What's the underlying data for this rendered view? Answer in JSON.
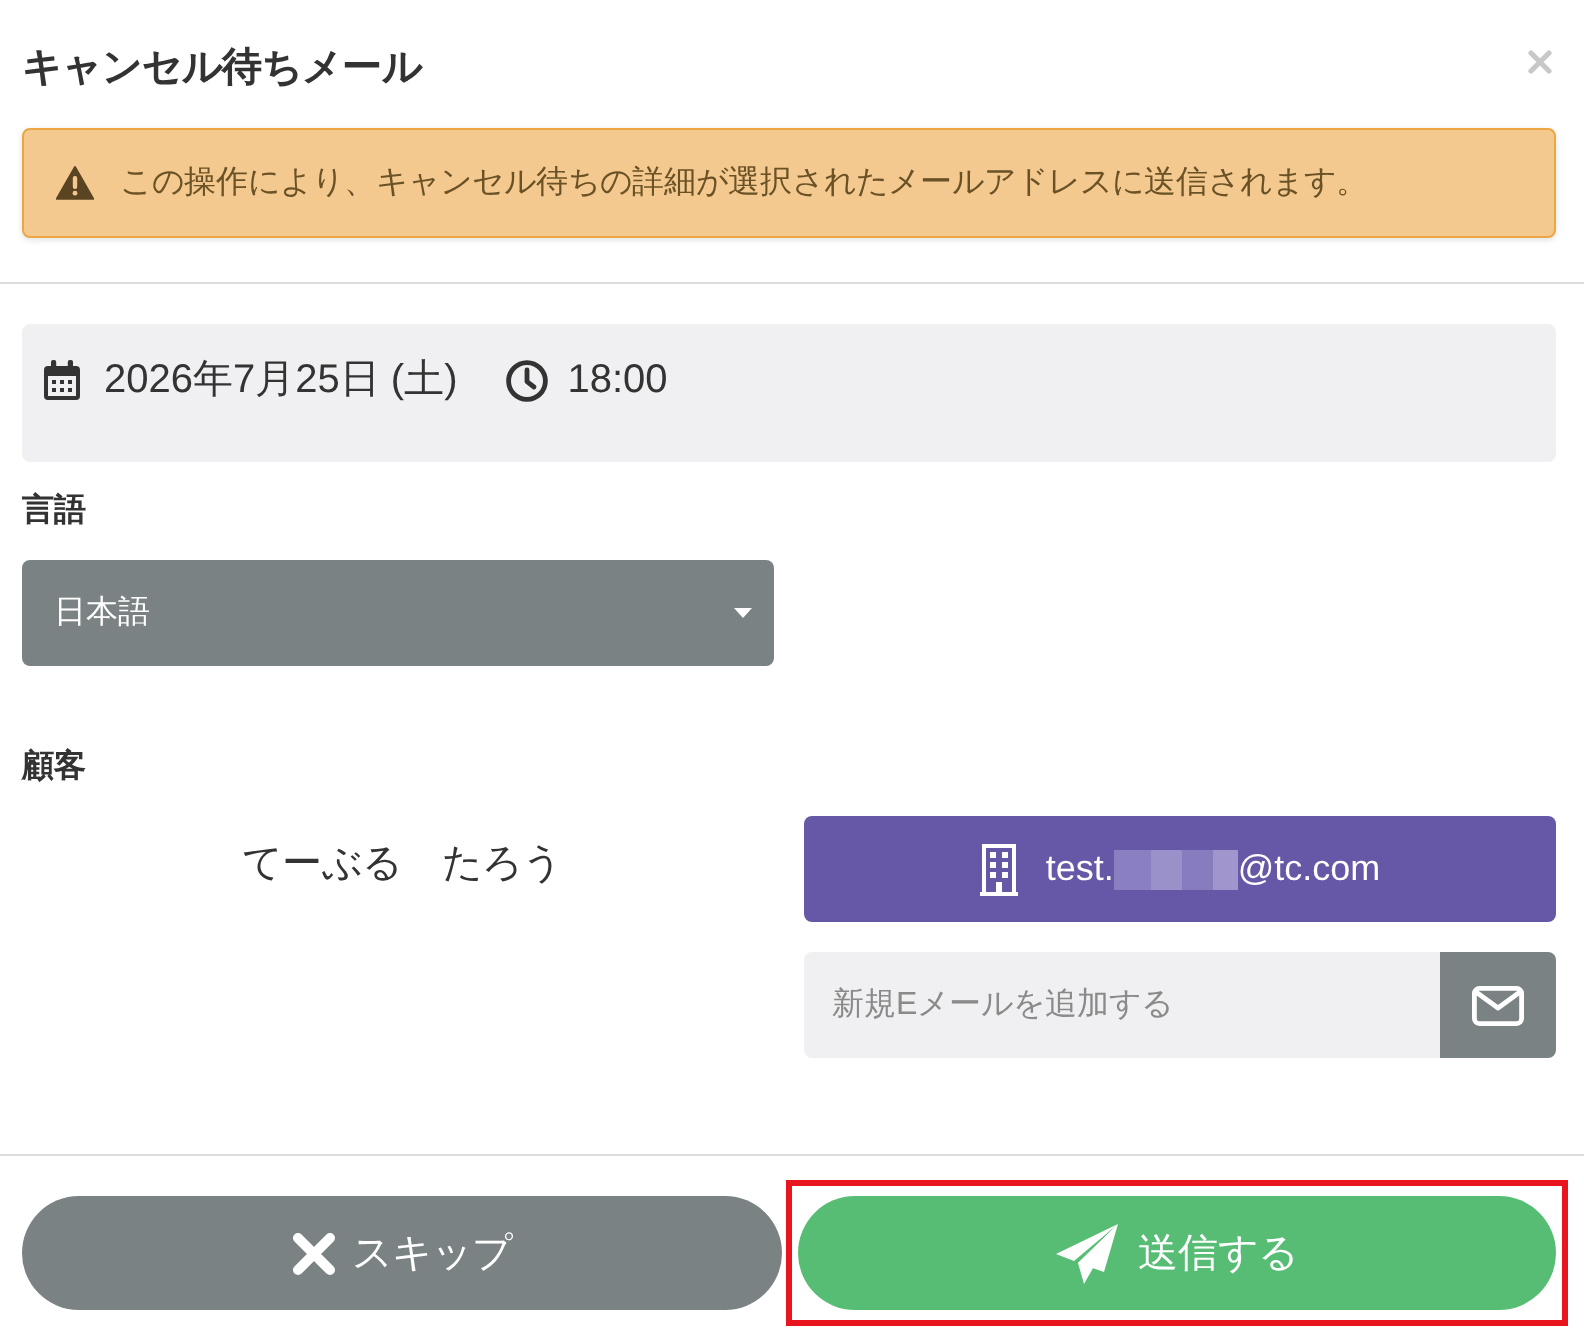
{
  "title": "キャンセル待ちメール",
  "alert": {
    "text": "この操作により、キャンセル待ちの詳細が選択されたメールアドレスに送信されます。"
  },
  "schedule": {
    "date": "2026年7月25日 (土)",
    "time": "18:00"
  },
  "language": {
    "label": "言語",
    "value": "日本語"
  },
  "customer": {
    "label": "顧客",
    "name": "てーぶる　たろう",
    "email": {
      "prefix": "test.",
      "suffix": "@tc.com",
      "redacted": true
    },
    "new_email": {
      "placeholder": "新規Eメールを追加する"
    }
  },
  "buttons": [
    {
      "kind": "skip",
      "label": "スキップ",
      "highlighted": false
    },
    {
      "kind": "send",
      "label": "送信する",
      "highlighted": true
    }
  ]
}
